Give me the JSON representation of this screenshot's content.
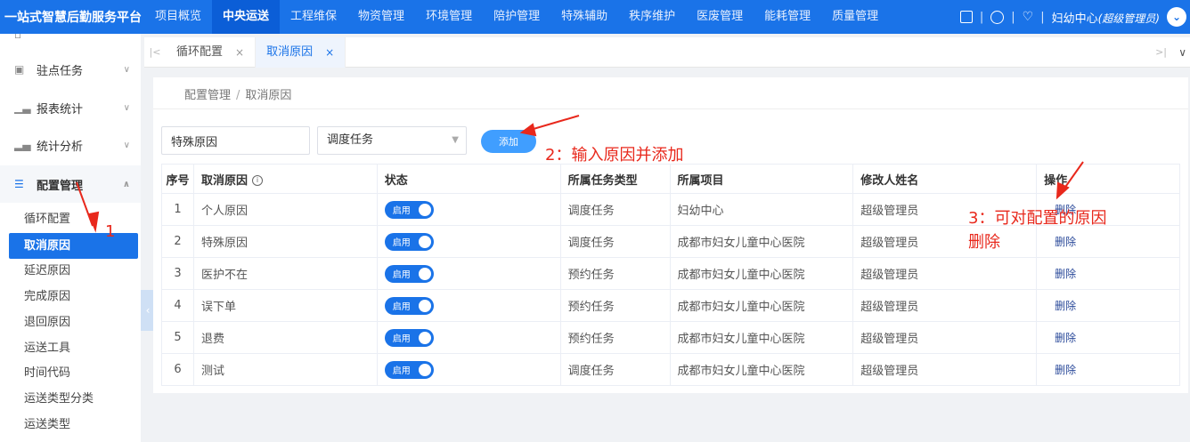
{
  "app": {
    "title": "一站式智慧后勤服务平台"
  },
  "top_nav": [
    "项目概览",
    "中央运送",
    "工程维保",
    "物资管理",
    "环境管理",
    "陪护管理",
    "特殊辅助",
    "秩序维护",
    "医废管理",
    "能耗管理",
    "质量管理"
  ],
  "top_nav_active": 1,
  "user": {
    "name": "妇幼中心",
    "role": "(超级管理员)"
  },
  "sidebar": {
    "groups": [
      "驻点任务",
      "报表统计",
      "统计分析",
      "配置管理"
    ],
    "sub_items": [
      "循环配置",
      "取消原因",
      "延迟原因",
      "完成原因",
      "退回原因",
      "运送工具",
      "时间代码",
      "运送类型分类",
      "运送类型"
    ],
    "active_sub": 1
  },
  "tabs": [
    {
      "label": "循环配置",
      "close": "×"
    },
    {
      "label": "取消原因",
      "close": "×"
    }
  ],
  "breadcrumb": {
    "parent": "配置管理",
    "separator": "/",
    "current": "取消原因"
  },
  "form": {
    "reason_value": "特殊原因",
    "type_selected": "调度任务",
    "add_label": "添加"
  },
  "table": {
    "headers": [
      "序号",
      "取消原因",
      "状态",
      "所属任务类型",
      "所属项目",
      "修改人姓名",
      "操作"
    ],
    "info_icon": "i",
    "rows": [
      {
        "idx": "1",
        "reason": "个人原因",
        "status": "启用",
        "task_type": "调度任务",
        "project": "妇幼中心",
        "modifier": "超级管理员",
        "action": "删除"
      },
      {
        "idx": "2",
        "reason": "特殊原因",
        "status": "启用",
        "task_type": "调度任务",
        "project": "成都市妇女儿童中心医院",
        "modifier": "超级管理员",
        "action": "删除"
      },
      {
        "idx": "3",
        "reason": "医护不在",
        "status": "启用",
        "task_type": "预约任务",
        "project": "成都市妇女儿童中心医院",
        "modifier": "超级管理员",
        "action": "删除"
      },
      {
        "idx": "4",
        "reason": "误下单",
        "status": "启用",
        "task_type": "预约任务",
        "project": "成都市妇女儿童中心医院",
        "modifier": "超级管理员",
        "action": "删除"
      },
      {
        "idx": "5",
        "reason": "退费",
        "status": "启用",
        "task_type": "预约任务",
        "project": "成都市妇女儿童中心医院",
        "modifier": "超级管理员",
        "action": "删除"
      },
      {
        "idx": "6",
        "reason": "测试",
        "status": "启用",
        "task_type": "调度任务",
        "project": "成都市妇女儿童中心医院",
        "modifier": "超级管理员",
        "action": "删除"
      }
    ]
  },
  "annotations": {
    "step1": "1",
    "step2": "2：输入原因并添加",
    "step3_line1": "3：可对配置的原因",
    "step3_line2": "删除",
    "color": "#e8281c"
  },
  "colors": {
    "primary": "#1a73e8",
    "button": "#409eff"
  }
}
